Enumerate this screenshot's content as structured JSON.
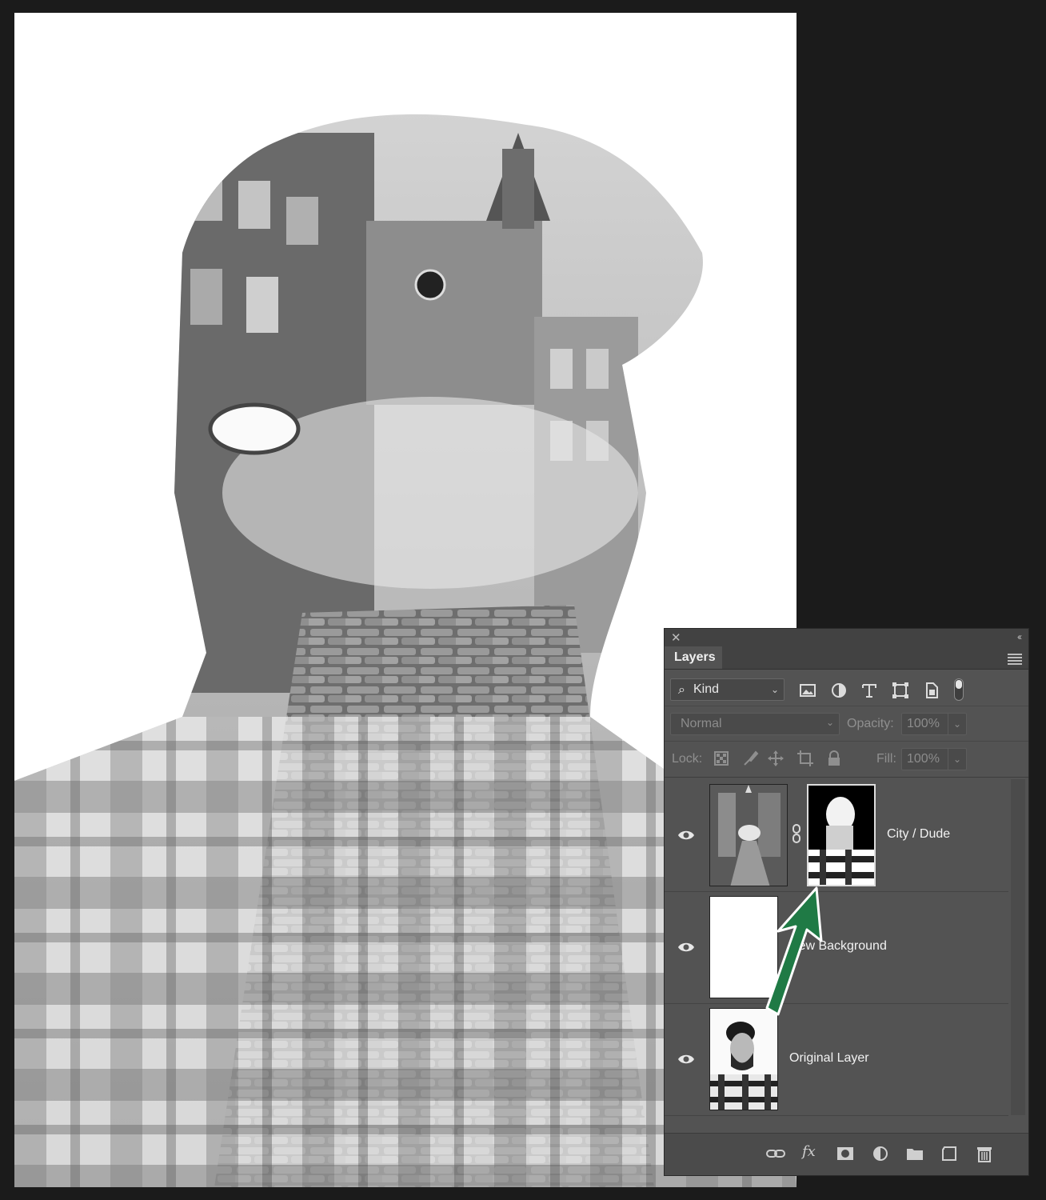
{
  "panel": {
    "tab_label": "Layers",
    "close_icon": "close-icon",
    "collapse_icon": "double-chevron-left-icon",
    "menu_icon": "panel-menu-icon",
    "filter": {
      "kind_label": "Kind",
      "icons": [
        "image-filter-icon",
        "adjustment-filter-icon",
        "type-filter-icon",
        "shape-filter-icon",
        "smart-object-filter-icon"
      ]
    },
    "blend_mode": "Normal",
    "opacity_label": "Opacity:",
    "opacity_value": "100%",
    "lock_label": "Lock:",
    "fill_label": "Fill:",
    "fill_value": "100%",
    "layers": [
      {
        "name": "City / Dude",
        "visible": true,
        "has_mask": true
      },
      {
        "name": "New Background",
        "visible": true,
        "has_mask": false
      },
      {
        "name": "Original Layer",
        "visible": true,
        "has_mask": false
      }
    ],
    "bottom_icons": [
      "link-layers-icon",
      "fx-icon",
      "add-mask-icon",
      "adjustment-layer-icon",
      "group-folder-icon",
      "new-layer-icon",
      "trash-icon"
    ]
  },
  "annotation": {
    "arrow_color": "#1f7a45"
  }
}
